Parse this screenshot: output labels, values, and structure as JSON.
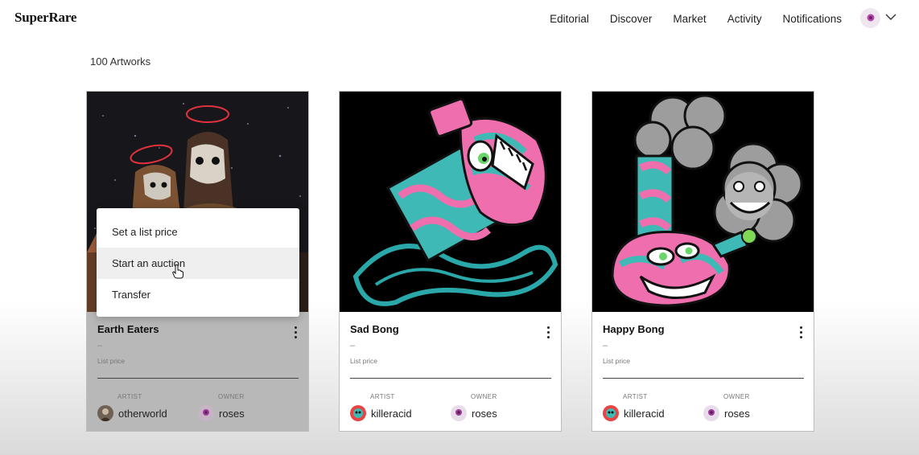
{
  "header": {
    "logo": "SuperRare",
    "nav": [
      "Editorial",
      "Discover",
      "Market",
      "Activity",
      "Notifications"
    ]
  },
  "collection": {
    "count_label": "100 Artworks"
  },
  "labels": {
    "artist": "ARTIST",
    "owner": "OWNER",
    "list_price": "List price",
    "price_placeholder": "–"
  },
  "context_menu": {
    "items": [
      "Set a list price",
      "Start an auction",
      "Transfer"
    ],
    "hovered": "Start an auction"
  },
  "cards": [
    {
      "title": "Earth Eaters",
      "artist": "otherworld",
      "owner": "roses"
    },
    {
      "title": "Sad Bong",
      "artist": "killeracid",
      "owner": "roses"
    },
    {
      "title": "Happy Bong",
      "artist": "killeracid",
      "owner": "roses"
    }
  ],
  "colors": {
    "teal": "#3fb9b5",
    "pink": "#ef6fae",
    "black": "#000000",
    "overlay": "#b8b8b8"
  }
}
